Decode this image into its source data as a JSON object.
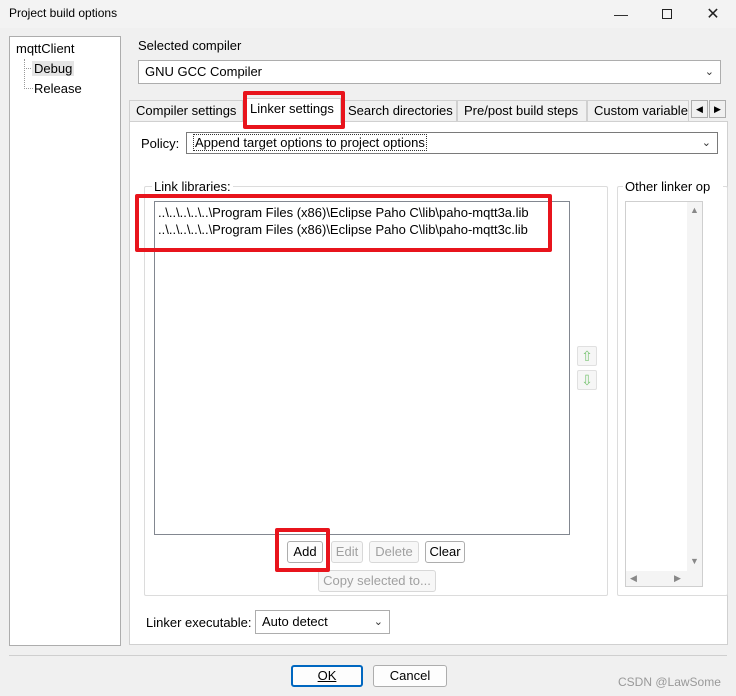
{
  "window": {
    "title": "Project build options",
    "minimize_glyph": "—",
    "close_glyph": "✕"
  },
  "tree": {
    "root": "mqttClient",
    "children": [
      "Debug",
      "Release"
    ],
    "selected": "Debug"
  },
  "compiler": {
    "label": "Selected compiler",
    "value": "GNU GCC Compiler"
  },
  "tabs": {
    "items": [
      "Compiler settings",
      "Linker settings",
      "Search directories",
      "Pre/post build steps",
      "Custom variable"
    ],
    "active": "Linker settings",
    "scroll_left": "◀",
    "scroll_right": "▶"
  },
  "policy": {
    "label": "Policy:",
    "value": "Append target options to project options"
  },
  "link_libraries": {
    "label": "Link libraries:",
    "items": [
      "..\\..\\..\\..\\..\\Program Files (x86)\\Eclipse Paho C\\lib\\paho-mqtt3a.lib",
      "..\\..\\..\\..\\..\\Program Files (x86)\\Eclipse Paho C\\lib\\paho-mqtt3c.lib"
    ],
    "up_glyph": "⇧",
    "down_glyph": "⇩"
  },
  "buttons": {
    "add": "Add",
    "edit": "Edit",
    "delete": "Delete",
    "clear": "Clear",
    "copy_selected": "Copy selected to..."
  },
  "other_linker": {
    "label": "Other linker op"
  },
  "linker_executable": {
    "label": "Linker executable:",
    "value": "Auto detect"
  },
  "dialog": {
    "ok": "OK",
    "cancel": "Cancel"
  },
  "watermark": "CSDN @LawSome",
  "colors": {
    "highlight": "#e8141c",
    "accent_arrow": "#7cc576"
  }
}
